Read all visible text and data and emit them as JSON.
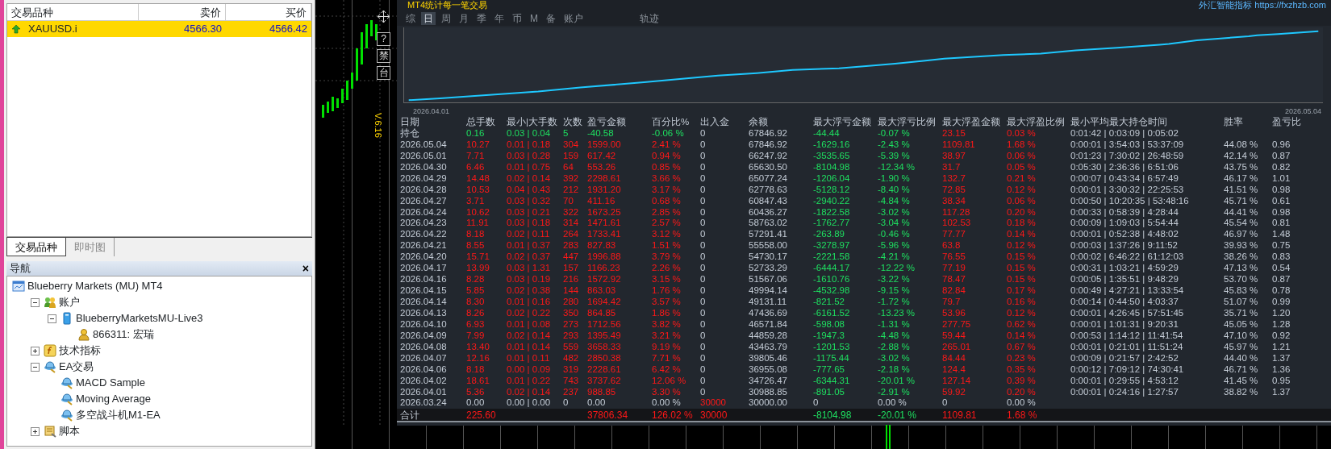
{
  "market_watch": {
    "columns": [
      "交易品种",
      "卖价",
      "买价"
    ],
    "rows": [
      {
        "symbol": "XAUUSD.i",
        "bid": "4566.30",
        "ask": "4566.42",
        "selected": true
      }
    ]
  },
  "market_tabs": [
    {
      "label": "交易品种",
      "selected": true
    },
    {
      "label": "即时图",
      "selected": false
    }
  ],
  "navigator": {
    "title": "导航",
    "close": "×",
    "tree": [
      {
        "label": "Blueberry Markets (MU) MT4",
        "kind": "terminal",
        "children": [
          {
            "label": "账户",
            "kind": "accounts",
            "expanded": true,
            "children": [
              {
                "label": "BlueberryMarketsMU-Live3",
                "kind": "server",
                "expanded": true,
                "children": [
                  {
                    "label": "866311: 宏瑞",
                    "kind": "user"
                  }
                ]
              }
            ]
          },
          {
            "label": "技术指标",
            "kind": "indicators",
            "expanded": false
          },
          {
            "label": "EA交易",
            "kind": "experts",
            "expanded": true,
            "children": [
              {
                "label": "MACD Sample",
                "kind": "expert"
              },
              {
                "label": "Moving Average",
                "kind": "expert"
              },
              {
                "label": "多空战斗机M1-EA",
                "kind": "expert"
              }
            ]
          },
          {
            "label": "脚本",
            "kind": "scripts",
            "expanded": false
          }
        ]
      }
    ]
  },
  "chart": {
    "side_buttons": [
      "?",
      "禁",
      "台"
    ],
    "version": "V.6.16"
  },
  "stats": {
    "title": "MT4统计每一笔交易",
    "link": "外汇智能指标 https://fxzhzb.com",
    "tabs": [
      {
        "label": "综",
        "selected": false
      },
      {
        "label": "日",
        "selected": true
      },
      {
        "label": "周",
        "selected": false
      },
      {
        "label": "月",
        "selected": false
      },
      {
        "label": "季",
        "selected": false
      },
      {
        "label": "年",
        "selected": false
      },
      {
        "label": "币",
        "selected": false
      },
      {
        "label": "M",
        "selected": false
      },
      {
        "label": "备",
        "selected": false
      },
      {
        "label": "账户",
        "selected": false
      }
    ],
    "more_tabs": [
      {
        "label": "轨迹",
        "selected": false
      }
    ],
    "curve": {
      "start_label": "2026.04.01",
      "end_label": "2026.05.04"
    },
    "columns": [
      "日期",
      "总手数",
      "最小|大手数",
      "次数",
      "盈亏金额",
      "百分比%",
      "出入金",
      "余额",
      "最大浮亏金额",
      "最大浮亏比例",
      "最大浮盈金额",
      "最大浮盈比例",
      "最小平均最大持仓时间",
      "胜率",
      "盈亏比"
    ],
    "rows": [
      {
        "kind": "open",
        "cells": [
          "持仓",
          "0.16",
          "0.03 | 0.04",
          "5",
          "-40.58",
          "-0.06 %",
          "0",
          "67846.92",
          "-44.44",
          "-0.07 %",
          "23.15",
          "0.03 %",
          "0:01:42 | 0:03:09 | 0:05:02",
          null,
          null
        ]
      },
      {
        "kind": "day",
        "cells": [
          "2026.05.04",
          "10.27",
          "0.01 | 0.18",
          "304",
          "1599.00",
          "2.41 %",
          "0",
          "67846.92",
          "-1629.16",
          "-2.43 %",
          "1109.81",
          "1.68 %",
          "0:00:01 | 3:54:03 | 53:37:09",
          "44.08 %",
          "0.96"
        ]
      },
      {
        "kind": "day",
        "cells": [
          "2026.05.01",
          "7.71",
          "0.03 | 0.28",
          "159",
          "617.42",
          "0.94 %",
          "0",
          "66247.92",
          "-3535.65",
          "-5.39 %",
          "38.97",
          "0.06 %",
          "0:01:23 | 7:30:02 | 26:48:59",
          "42.14 %",
          "0.87"
        ]
      },
      {
        "kind": "day",
        "cells": [
          "2026.04.30",
          "6.46",
          "0.01 | 0.75",
          "64",
          "553.26",
          "0.85 %",
          "0",
          "65630.50",
          "-8104.98",
          "-12.34 %",
          "31.7",
          "0.05 %",
          "0:05:30 | 2:36:36 | 6:51:06",
          "43.75 %",
          "0.82"
        ]
      },
      {
        "kind": "day",
        "cells": [
          "2026.04.29",
          "14.48",
          "0.02 | 0.14",
          "392",
          "2298.61",
          "3.66 %",
          "0",
          "65077.24",
          "-1206.04",
          "-1.90 %",
          "132.7",
          "0.21 %",
          "0:00:07 | 0:43:34 | 6:57:49",
          "46.17 %",
          "1.01"
        ]
      },
      {
        "kind": "day",
        "cells": [
          "2026.04.28",
          "10.53",
          "0.04 | 0.43",
          "212",
          "1931.20",
          "3.17 %",
          "0",
          "62778.63",
          "-5128.12",
          "-8.40 %",
          "72.85",
          "0.12 %",
          "0:00:01 | 3:30:32 | 22:25:53",
          "41.51 %",
          "0.98"
        ]
      },
      {
        "kind": "day",
        "cells": [
          "2026.04.27",
          "3.71",
          "0.03 | 0.32",
          "70",
          "411.16",
          "0.68 %",
          "0",
          "60847.43",
          "-2940.22",
          "-4.84 %",
          "38.34",
          "0.06 %",
          "0:00:50 | 10:20:35 | 53:48:16",
          "45.71 %",
          "0.61"
        ]
      },
      {
        "kind": "day",
        "cells": [
          "2026.04.24",
          "10.62",
          "0.03 | 0.21",
          "322",
          "1673.25",
          "2.85 %",
          "0",
          "60436.27",
          "-1822.58",
          "-3.02 %",
          "117.28",
          "0.20 %",
          "0:00:33 | 0:58:39 | 4:28:44",
          "44.41 %",
          "0.98"
        ]
      },
      {
        "kind": "day",
        "cells": [
          "2026.04.23",
          "11.91",
          "0.03 | 0.18",
          "314",
          "1471.61",
          "2.57 %",
          "0",
          "58763.02",
          "-1762.77",
          "-3.04 %",
          "102.53",
          "0.18 %",
          "0:00:09 | 1:09:03 | 5:54:44",
          "45.54 %",
          "0.81"
        ]
      },
      {
        "kind": "day",
        "cells": [
          "2026.04.22",
          "8.18",
          "0.02 | 0.11",
          "264",
          "1733.41",
          "3.12 %",
          "0",
          "57291.41",
          "-263.89",
          "-0.46 %",
          "77.77",
          "0.14 %",
          "0:00:01 | 0:52:38 | 4:48:02",
          "46.97 %",
          "1.48"
        ]
      },
      {
        "kind": "day",
        "cells": [
          "2026.04.21",
          "8.55",
          "0.01 | 0.37",
          "283",
          "827.83",
          "1.51 %",
          "0",
          "55558.00",
          "-3278.97",
          "-5.96 %",
          "63.8",
          "0.12 %",
          "0:00:03 | 1:37:26 | 9:11:52",
          "39.93 %",
          "0.75"
        ]
      },
      {
        "kind": "day",
        "cells": [
          "2026.04.20",
          "15.71",
          "0.02 | 0.37",
          "447",
          "1996.88",
          "3.79 %",
          "0",
          "54730.17",
          "-2221.58",
          "-4.21 %",
          "76.55",
          "0.15 %",
          "0:00:02 | 6:46:22 | 61:12:03",
          "38.26 %",
          "0.83"
        ]
      },
      {
        "kind": "day",
        "cells": [
          "2026.04.17",
          "13.99",
          "0.03 | 1.31",
          "157",
          "1166.23",
          "2.26 %",
          "0",
          "52733.29",
          "-6444.17",
          "-12.22 %",
          "77.19",
          "0.15 %",
          "0:00:31 | 1:03:21 | 4:59:29",
          "47.13 %",
          "0.54"
        ]
      },
      {
        "kind": "day",
        "cells": [
          "2026.04.16",
          "8.28",
          "0.03 | 0.19",
          "216",
          "1572.92",
          "3.15 %",
          "0",
          "51567.06",
          "-1610.76",
          "-3.22 %",
          "78.47",
          "0.15 %",
          "0:00:05 | 1:35:51 | 9:48:29",
          "53.70 %",
          "0.87"
        ]
      },
      {
        "kind": "day",
        "cells": [
          "2026.04.15",
          "5.85",
          "0.02 | 0.38",
          "144",
          "863.03",
          "1.76 %",
          "0",
          "49994.14",
          "-4532.98",
          "-9.15 %",
          "82.84",
          "0.17 %",
          "0:00:49 | 4:27:21 | 13:33:54",
          "45.83 %",
          "0.78"
        ]
      },
      {
        "kind": "day",
        "cells": [
          "2026.04.14",
          "8.30",
          "0.01 | 0.16",
          "280",
          "1694.42",
          "3.57 %",
          "0",
          "49131.11",
          "-821.52",
          "-1.72 %",
          "79.7",
          "0.16 %",
          "0:00:14 | 0:44:50 | 4:03:37",
          "51.07 %",
          "0.99"
        ]
      },
      {
        "kind": "day",
        "cells": [
          "2026.04.13",
          "8.26",
          "0.02 | 0.22",
          "350",
          "864.85",
          "1.86 %",
          "0",
          "47436.69",
          "-6161.52",
          "-13.23 %",
          "53.96",
          "0.12 %",
          "0:00:01 | 4:26:45 | 57:51:45",
          "35.71 %",
          "1.20"
        ]
      },
      {
        "kind": "day",
        "cells": [
          "2026.04.10",
          "6.93",
          "0.01 | 0.08",
          "273",
          "1712.56",
          "3.82 %",
          "0",
          "46571.84",
          "-598.08",
          "-1.31 %",
          "277.75",
          "0.62 %",
          "0:00:01 | 1:01:31 | 9:20:31",
          "45.05 %",
          "1.28"
        ]
      },
      {
        "kind": "day",
        "cells": [
          "2026.04.09",
          "7.99",
          "0.02 | 0.14",
          "293",
          "1395.49",
          "3.21 %",
          "0",
          "44859.28",
          "-1947.3",
          "-4.48 %",
          "59.44",
          "0.14 %",
          "0:00:53 | 1:14:12 | 11:41:54",
          "47.10 %",
          "0.92"
        ]
      },
      {
        "kind": "day",
        "cells": [
          "2026.04.08",
          "13.40",
          "0.01 | 0.14",
          "559",
          "3658.33",
          "9.19 %",
          "0",
          "43463.79",
          "-1201.53",
          "-2.88 %",
          "265.01",
          "0.67 %",
          "0:00:01 | 0:21:01 | 11:51:24",
          "45.97 %",
          "1.21"
        ]
      },
      {
        "kind": "day",
        "cells": [
          "2026.04.07",
          "12.16",
          "0.01 | 0.11",
          "482",
          "2850.38",
          "7.71 %",
          "0",
          "39805.46",
          "-1175.44",
          "-3.02 %",
          "84.44",
          "0.23 %",
          "0:00:09 | 0:21:57 | 2:42:52",
          "44.40 %",
          "1.37"
        ]
      },
      {
        "kind": "day",
        "cells": [
          "2026.04.06",
          "8.18",
          "0.00 | 0.09",
          "319",
          "2228.61",
          "6.42 %",
          "0",
          "36955.08",
          "-777.65",
          "-2.18 %",
          "124.4",
          "0.35 %",
          "0:00:12 | 7:09:12 | 74:30:41",
          "46.71 %",
          "1.36"
        ]
      },
      {
        "kind": "day",
        "cells": [
          "2026.04.02",
          "18.61",
          "0.01 | 0.22",
          "743",
          "3737.62",
          "12.06 %",
          "0",
          "34726.47",
          "-6344.31",
          "-20.01 %",
          "127.14",
          "0.39 %",
          "0:00:01 | 0:29:55 | 4:53:12",
          "41.45 %",
          "0.95"
        ]
      },
      {
        "kind": "day",
        "cells": [
          "2026.04.01",
          "5.36",
          "0.02 | 0.14",
          "237",
          "988.85",
          "3.30 %",
          "0",
          "30988.85",
          "-891.05",
          "-2.91 %",
          "59.92",
          "0.20 %",
          "0:00:01 | 0:24:16 | 1:27:57",
          "38.82 %",
          "1.37"
        ]
      },
      {
        "kind": "deposit",
        "cells": [
          "2026.03.24",
          "0.00",
          "0.00 | 0.00",
          "0",
          "0.00",
          "0.00 %",
          "30000",
          "30000.00",
          "0",
          "0.00 %",
          "0",
          "0.00 %",
          null,
          null,
          null
        ]
      },
      {
        "kind": "total",
        "cells": [
          "合计",
          "225.60",
          null,
          null,
          "37806.34",
          "126.02 %",
          "30000",
          null,
          "-8104.98",
          "-20.01 %",
          "1109.81",
          "1.68 %",
          null,
          null,
          null
        ]
      }
    ]
  }
}
